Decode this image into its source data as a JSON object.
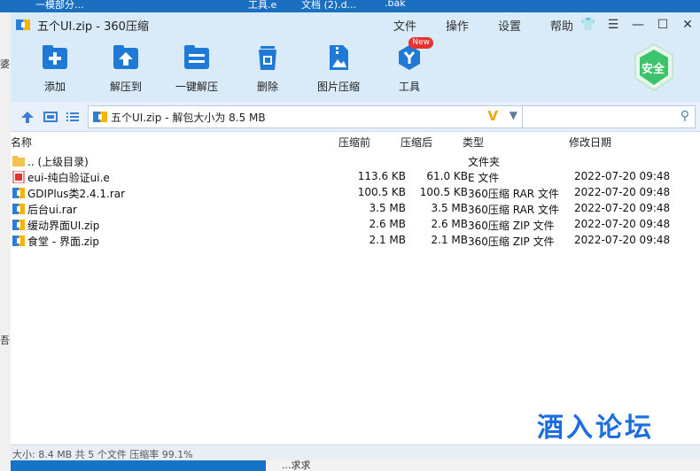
{
  "desktop": {
    "top_fragments": [
      "一模部分...",
      "工具.e",
      "文档 (2).d...",
      ".bak"
    ],
    "left_fragments": [
      "婆",
      "吾"
    ],
    "bottom_fragment": "...求求"
  },
  "window": {
    "title": "五个UI.zip - 360压缩",
    "menus": [
      "文件",
      "操作",
      "设置",
      "帮助"
    ]
  },
  "toolbar": {
    "items": [
      {
        "label": "添加",
        "icon": "add-icon"
      },
      {
        "label": "解压到",
        "icon": "extract-to-icon"
      },
      {
        "label": "一键解压",
        "icon": "quick-extract-icon"
      },
      {
        "label": "删除",
        "icon": "delete-icon"
      },
      {
        "label": "图片压缩",
        "icon": "image-compress-icon"
      },
      {
        "label": "工具",
        "icon": "tools-icon",
        "badge": "New"
      }
    ],
    "safe_label": "安全"
  },
  "address": {
    "path": "五个UI.zip - 解包大小为 8.5 MB",
    "search_value": ""
  },
  "columns": {
    "name": "名称",
    "packed": "压缩前",
    "unpacked": "压缩后",
    "type": "类型",
    "date": "修改日期"
  },
  "files": [
    {
      "name": ".. (上级目录)",
      "packed": "",
      "unpacked": "",
      "type": "文件夹",
      "date": "",
      "icon": "folder-icon"
    },
    {
      "name": "eui-纯白验证ui.e",
      "packed": "113.6 KB",
      "unpacked": "61.0 KB",
      "type": "E 文件",
      "date": "2022-07-20 09:48",
      "icon": "e-file-icon"
    },
    {
      "name": "GDIPlus类2.4.1.rar",
      "packed": "100.5 KB",
      "unpacked": "100.5 KB",
      "type": "360压缩 RAR 文件",
      "date": "2022-07-20 09:48",
      "icon": "archive-icon"
    },
    {
      "name": "后台ui.rar",
      "packed": "3.5 MB",
      "unpacked": "3.5 MB",
      "type": "360压缩 RAR 文件",
      "date": "2022-07-20 09:48",
      "icon": "archive-icon"
    },
    {
      "name": "缓动界面UI.zip",
      "packed": "2.6 MB",
      "unpacked": "2.6 MB",
      "type": "360压缩 ZIP 文件",
      "date": "2022-07-20 09:48",
      "icon": "archive-icon"
    },
    {
      "name": "食堂 - 界面.zip",
      "packed": "2.1 MB",
      "unpacked": "2.1 MB",
      "type": "360压缩 ZIP 文件",
      "date": "2022-07-20 09:48",
      "icon": "archive-icon"
    }
  ],
  "status": "大小: 8.4 MB 共 5 个文件 压缩率 99.1%",
  "watermark": "酒入论坛",
  "colors": {
    "accent": "#1e7ad6",
    "toolbar_bg": "#d9eaf9",
    "safe_green": "#3cc36b"
  }
}
